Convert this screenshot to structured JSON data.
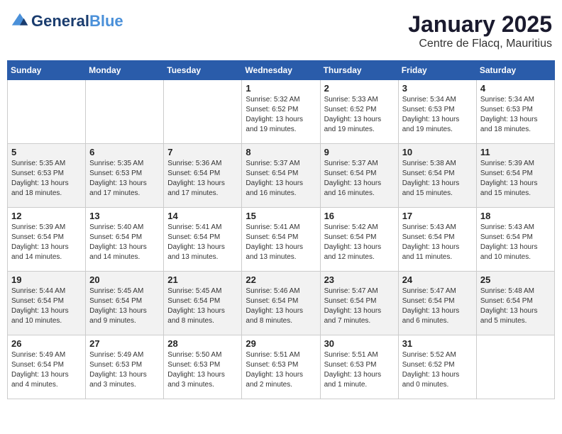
{
  "header": {
    "logo_line1": "General",
    "logo_line2": "Blue",
    "title": "January 2025",
    "subtitle": "Centre de Flacq, Mauritius"
  },
  "weekdays": [
    "Sunday",
    "Monday",
    "Tuesday",
    "Wednesday",
    "Thursday",
    "Friday",
    "Saturday"
  ],
  "weeks": [
    [
      {
        "day": "",
        "info": ""
      },
      {
        "day": "",
        "info": ""
      },
      {
        "day": "",
        "info": ""
      },
      {
        "day": "1",
        "info": "Sunrise: 5:32 AM\nSunset: 6:52 PM\nDaylight: 13 hours\nand 19 minutes."
      },
      {
        "day": "2",
        "info": "Sunrise: 5:33 AM\nSunset: 6:52 PM\nDaylight: 13 hours\nand 19 minutes."
      },
      {
        "day": "3",
        "info": "Sunrise: 5:34 AM\nSunset: 6:53 PM\nDaylight: 13 hours\nand 19 minutes."
      },
      {
        "day": "4",
        "info": "Sunrise: 5:34 AM\nSunset: 6:53 PM\nDaylight: 13 hours\nand 18 minutes."
      }
    ],
    [
      {
        "day": "5",
        "info": "Sunrise: 5:35 AM\nSunset: 6:53 PM\nDaylight: 13 hours\nand 18 minutes."
      },
      {
        "day": "6",
        "info": "Sunrise: 5:35 AM\nSunset: 6:53 PM\nDaylight: 13 hours\nand 17 minutes."
      },
      {
        "day": "7",
        "info": "Sunrise: 5:36 AM\nSunset: 6:54 PM\nDaylight: 13 hours\nand 17 minutes."
      },
      {
        "day": "8",
        "info": "Sunrise: 5:37 AM\nSunset: 6:54 PM\nDaylight: 13 hours\nand 16 minutes."
      },
      {
        "day": "9",
        "info": "Sunrise: 5:37 AM\nSunset: 6:54 PM\nDaylight: 13 hours\nand 16 minutes."
      },
      {
        "day": "10",
        "info": "Sunrise: 5:38 AM\nSunset: 6:54 PM\nDaylight: 13 hours\nand 15 minutes."
      },
      {
        "day": "11",
        "info": "Sunrise: 5:39 AM\nSunset: 6:54 PM\nDaylight: 13 hours\nand 15 minutes."
      }
    ],
    [
      {
        "day": "12",
        "info": "Sunrise: 5:39 AM\nSunset: 6:54 PM\nDaylight: 13 hours\nand 14 minutes."
      },
      {
        "day": "13",
        "info": "Sunrise: 5:40 AM\nSunset: 6:54 PM\nDaylight: 13 hours\nand 14 minutes."
      },
      {
        "day": "14",
        "info": "Sunrise: 5:41 AM\nSunset: 6:54 PM\nDaylight: 13 hours\nand 13 minutes."
      },
      {
        "day": "15",
        "info": "Sunrise: 5:41 AM\nSunset: 6:54 PM\nDaylight: 13 hours\nand 13 minutes."
      },
      {
        "day": "16",
        "info": "Sunrise: 5:42 AM\nSunset: 6:54 PM\nDaylight: 13 hours\nand 12 minutes."
      },
      {
        "day": "17",
        "info": "Sunrise: 5:43 AM\nSunset: 6:54 PM\nDaylight: 13 hours\nand 11 minutes."
      },
      {
        "day": "18",
        "info": "Sunrise: 5:43 AM\nSunset: 6:54 PM\nDaylight: 13 hours\nand 10 minutes."
      }
    ],
    [
      {
        "day": "19",
        "info": "Sunrise: 5:44 AM\nSunset: 6:54 PM\nDaylight: 13 hours\nand 10 minutes."
      },
      {
        "day": "20",
        "info": "Sunrise: 5:45 AM\nSunset: 6:54 PM\nDaylight: 13 hours\nand 9 minutes."
      },
      {
        "day": "21",
        "info": "Sunrise: 5:45 AM\nSunset: 6:54 PM\nDaylight: 13 hours\nand 8 minutes."
      },
      {
        "day": "22",
        "info": "Sunrise: 5:46 AM\nSunset: 6:54 PM\nDaylight: 13 hours\nand 8 minutes."
      },
      {
        "day": "23",
        "info": "Sunrise: 5:47 AM\nSunset: 6:54 PM\nDaylight: 13 hours\nand 7 minutes."
      },
      {
        "day": "24",
        "info": "Sunrise: 5:47 AM\nSunset: 6:54 PM\nDaylight: 13 hours\nand 6 minutes."
      },
      {
        "day": "25",
        "info": "Sunrise: 5:48 AM\nSunset: 6:54 PM\nDaylight: 13 hours\nand 5 minutes."
      }
    ],
    [
      {
        "day": "26",
        "info": "Sunrise: 5:49 AM\nSunset: 6:54 PM\nDaylight: 13 hours\nand 4 minutes."
      },
      {
        "day": "27",
        "info": "Sunrise: 5:49 AM\nSunset: 6:53 PM\nDaylight: 13 hours\nand 3 minutes."
      },
      {
        "day": "28",
        "info": "Sunrise: 5:50 AM\nSunset: 6:53 PM\nDaylight: 13 hours\nand 3 minutes."
      },
      {
        "day": "29",
        "info": "Sunrise: 5:51 AM\nSunset: 6:53 PM\nDaylight: 13 hours\nand 2 minutes."
      },
      {
        "day": "30",
        "info": "Sunrise: 5:51 AM\nSunset: 6:53 PM\nDaylight: 13 hours\nand 1 minute."
      },
      {
        "day": "31",
        "info": "Sunrise: 5:52 AM\nSunset: 6:52 PM\nDaylight: 13 hours\nand 0 minutes."
      },
      {
        "day": "",
        "info": ""
      }
    ]
  ]
}
